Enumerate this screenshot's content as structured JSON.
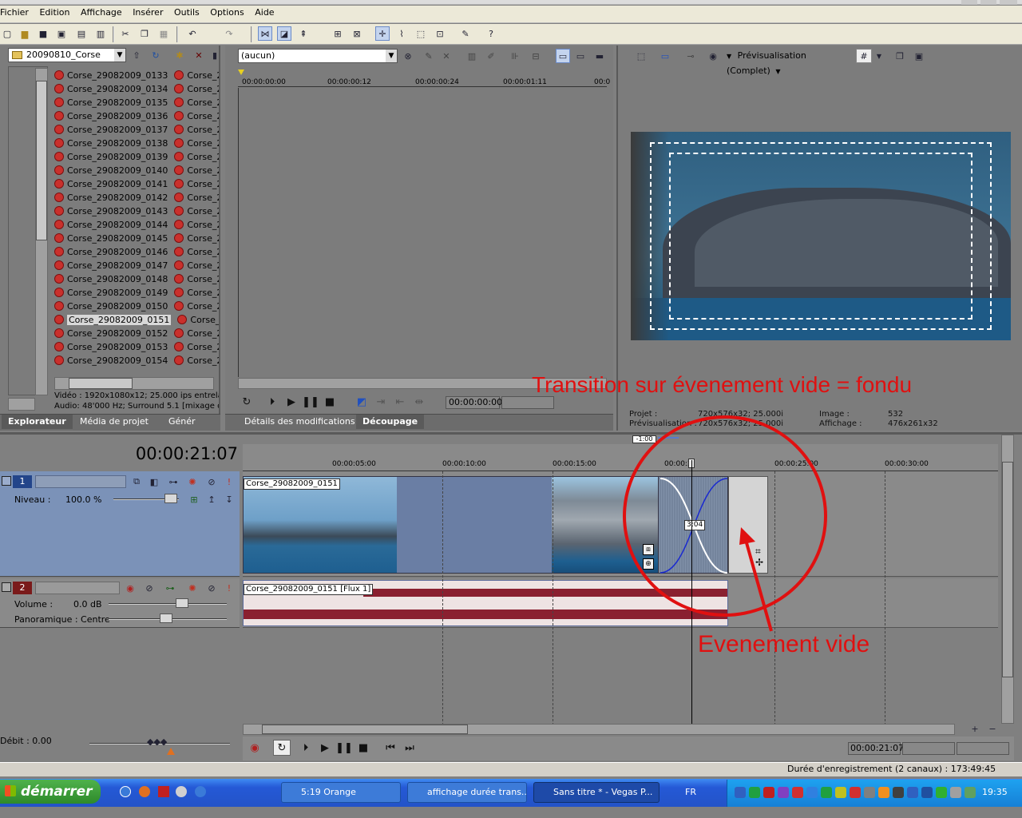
{
  "menu": [
    "Fichier",
    "Edition",
    "Affichage",
    "Insérer",
    "Outils",
    "Options",
    "Aide"
  ],
  "explorer": {
    "folder": "20090810_Corse",
    "files": [
      "Corse_29082009_0133",
      "Corse_29082009_0134",
      "Corse_29082009_0135",
      "Corse_29082009_0136",
      "Corse_29082009_0137",
      "Corse_29082009_0138",
      "Corse_29082009_0139",
      "Corse_29082009_0140",
      "Corse_29082009_0141",
      "Corse_29082009_0142",
      "Corse_29082009_0143",
      "Corse_29082009_0144",
      "Corse_29082009_0145",
      "Corse_29082009_0146",
      "Corse_29082009_0147",
      "Corse_29082009_0148",
      "Corse_29082009_0149",
      "Corse_29082009_0150",
      "Corse_29082009_0151",
      "Corse_29082009_0152",
      "Corse_29082009_0153",
      "Corse_29082009_0154"
    ],
    "second_col": "Corse_29",
    "selected": "Corse_29082009_0151",
    "info1": "Vidéo : 1920x1080x12; 25.000 ips entrelac",
    "info2": "Audio: 48'000 Hz; Surround 5.1 [mixage de",
    "tabs": [
      "Explorateur",
      "Média de projet",
      "Génér"
    ]
  },
  "trimmer": {
    "preset": "(aucun)",
    "ruler": [
      "00:00:00:00",
      "00:00:00:12",
      "00:00:00:24",
      "00:00:01:11",
      "00:0"
    ],
    "time": "00:00:00:00",
    "tabs": [
      "Détails des modifications",
      "Découpage"
    ]
  },
  "preview": {
    "mode": "Prévisualisation (Complet)",
    "projet_label": "Projet :",
    "projet_val": "720x576x32; 25.000i",
    "prev_label": "Prévisualisation :",
    "prev_val": "720x576x32; 25.000i",
    "image_label": "Image :",
    "image_val": "532",
    "affichage_label": "Affichage :",
    "affichage_val": "476x261x32"
  },
  "timeline": {
    "current_time": "00:00:21:07",
    "marker": "-1:00",
    "ruler": [
      "00:00:05:00",
      "00:00:10:00",
      "00:00:15:00",
      "00:00:2",
      "00:00:25:00",
      "00:00:30:00"
    ],
    "transition_label": "3:04",
    "video_clip": "Corse_29082009_0151",
    "audio_clip": "Corse_29082009_0151 [Flux 1]",
    "track1_num": "1",
    "track2_num": "2",
    "niveau_label": "Niveau :",
    "niveau_val": "100.0 %",
    "volume_label": "Volume :",
    "volume_val": "0.0 dB",
    "pan_label": "Panoramique : Centre",
    "debit": "Débit : 0.00",
    "end_time": "00:00:21:07",
    "status": "Durée d'enregistrement (2 canaux) : 173:49:45"
  },
  "annotations": {
    "transition_text": "Transition sur évenement vide = fondu",
    "event_text": "Evenement vide",
    "color": "#e01010"
  },
  "taskbar": {
    "start": "démarrer",
    "tasks": [
      "5:19 Orange",
      "affichage durée trans...",
      "Sans titre * - Vegas P..."
    ],
    "lang": "FR",
    "clock": "19:35"
  }
}
